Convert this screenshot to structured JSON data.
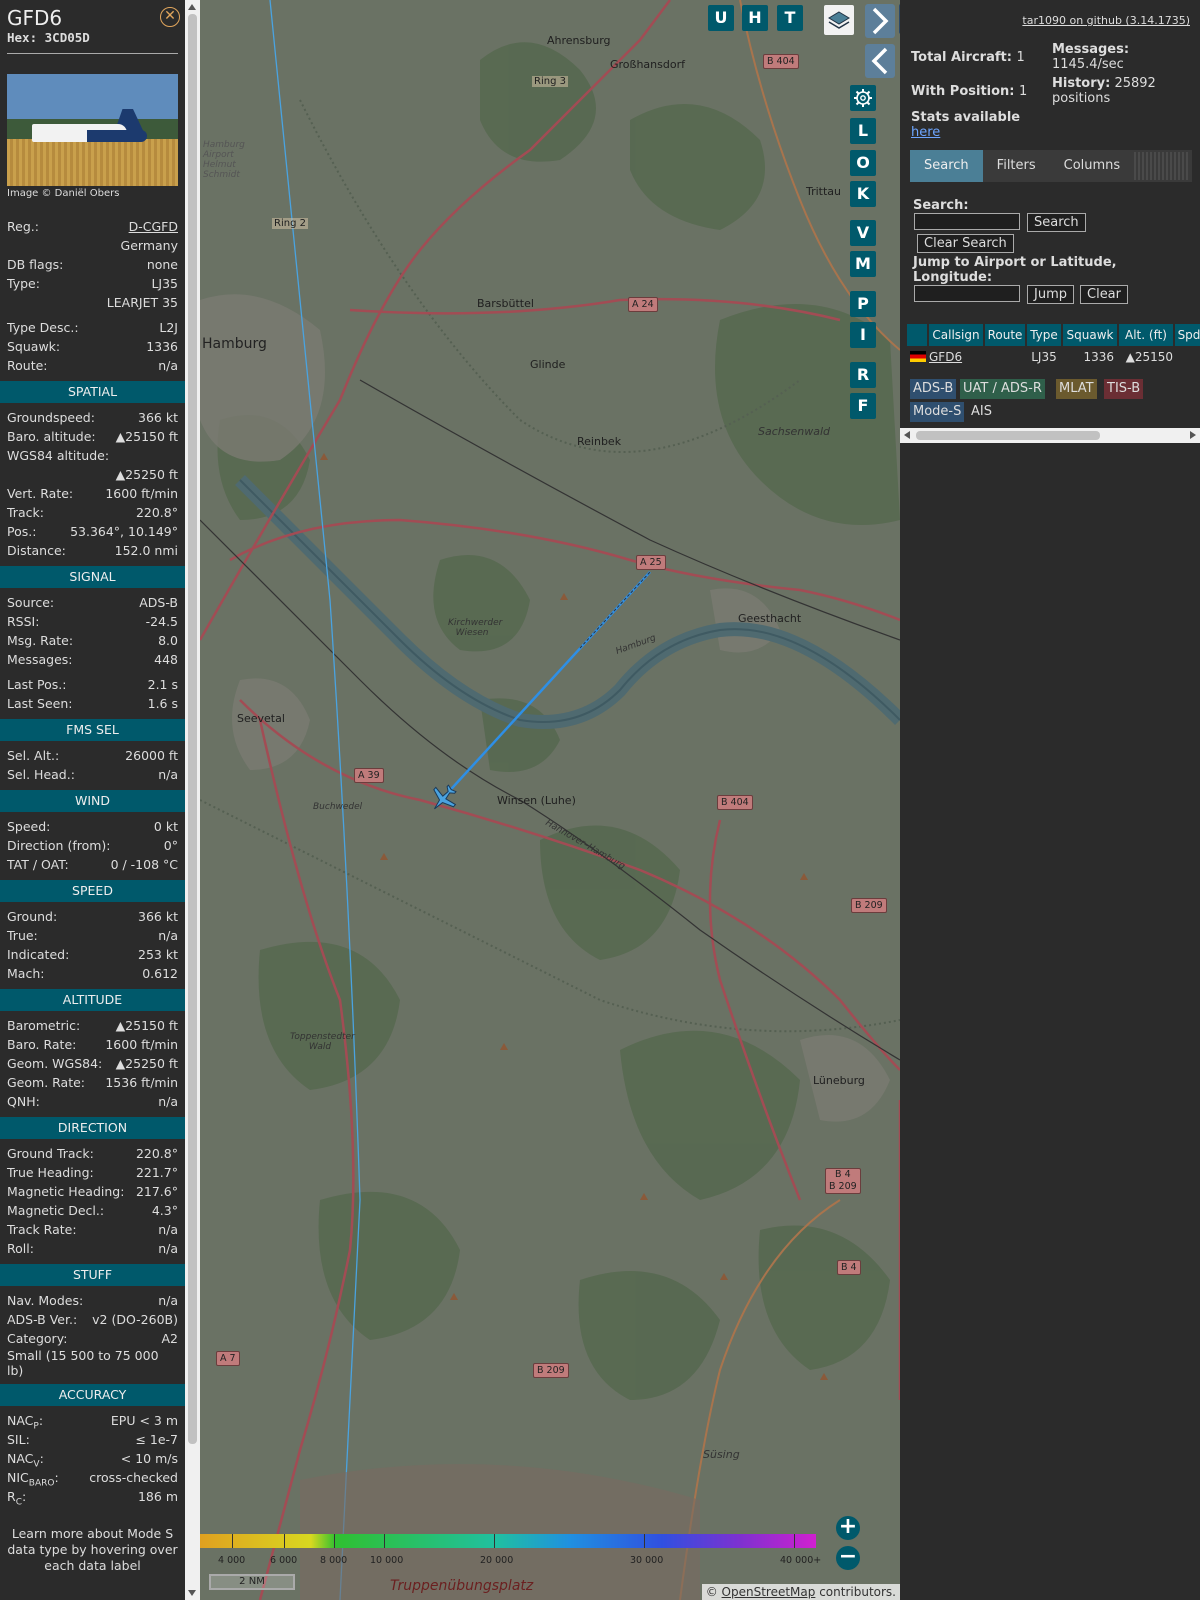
{
  "sidebar": {
    "callsign": "GFD6",
    "hex_label": "Hex:",
    "hex": "3CD05D",
    "close_icon": "close-circle-icon",
    "photo_credit": "Image © Daniël Obers",
    "info": [
      {
        "k": "Reg.:",
        "v": "D-CGFD",
        "link": true
      },
      {
        "k": "",
        "v": "Germany"
      },
      {
        "k": "DB flags:",
        "v": "none"
      },
      {
        "k": "Type:",
        "v": "LJ35"
      },
      {
        "k": "",
        "v": "LEARJET 35"
      },
      {
        "k": "Type Desc.:",
        "v": "L2J"
      },
      {
        "k": "Squawk:",
        "v": "1336"
      },
      {
        "k": "Route:",
        "v": "n/a"
      }
    ],
    "sections": {
      "spatial": {
        "title": "SPATIAL",
        "rows": [
          {
            "k": "Groundspeed:",
            "v": "366 kt"
          },
          {
            "k": "Baro. altitude:",
            "v": "▲25150 ft"
          },
          {
            "k": "WGS84 altitude:",
            "v": ""
          },
          {
            "k": "",
            "v": "▲25250 ft"
          },
          {
            "k": "Vert. Rate:",
            "v": "1600 ft/min"
          },
          {
            "k": "Track:",
            "v": "220.8°"
          },
          {
            "k": "Pos.:",
            "v": "53.364°, 10.149°"
          },
          {
            "k": "Distance:",
            "v": "152.0 nmi"
          }
        ]
      },
      "signal": {
        "title": "SIGNAL",
        "rows": [
          {
            "k": "Source:",
            "v": "ADS-B"
          },
          {
            "k": "RSSI:",
            "v": "-24.5"
          },
          {
            "k": "Msg. Rate:",
            "v": "8.0"
          },
          {
            "k": "Messages:",
            "v": "448"
          },
          {
            "k": "Last Pos.:",
            "v": "2.1 s"
          },
          {
            "k": "Last Seen:",
            "v": "1.6 s"
          }
        ]
      },
      "fms": {
        "title": "FMS SEL",
        "rows": [
          {
            "k": "Sel. Alt.:",
            "v": "26000 ft"
          },
          {
            "k": "Sel. Head.:",
            "v": "n/a"
          }
        ]
      },
      "wind": {
        "title": "WIND",
        "rows": [
          {
            "k": "Speed:",
            "v": "0 kt"
          },
          {
            "k": "Direction (from):",
            "v": "0°"
          },
          {
            "k": "TAT / OAT:",
            "v": "0 / -108 °C"
          }
        ]
      },
      "speed": {
        "title": "SPEED",
        "rows": [
          {
            "k": "Ground:",
            "v": "366 kt"
          },
          {
            "k": "True:",
            "v": "n/a"
          },
          {
            "k": "Indicated:",
            "v": "253 kt"
          },
          {
            "k": "Mach:",
            "v": "0.612"
          }
        ]
      },
      "altitude": {
        "title": "ALTITUDE",
        "rows": [
          {
            "k": "Barometric:",
            "v": "▲25150 ft"
          },
          {
            "k": "Baro. Rate:",
            "v": "1600 ft/min"
          },
          {
            "k": "Geom. WGS84:",
            "v": "▲25250 ft"
          },
          {
            "k": "Geom. Rate:",
            "v": "1536 ft/min"
          },
          {
            "k": "QNH:",
            "v": "n/a"
          }
        ]
      },
      "direction": {
        "title": "DIRECTION",
        "rows": [
          {
            "k": "Ground Track:",
            "v": "220.8°"
          },
          {
            "k": "True Heading:",
            "v": "221.7°"
          },
          {
            "k": "Magnetic Heading:",
            "v": "217.6°"
          },
          {
            "k": "Magnetic Decl.:",
            "v": "4.3°"
          },
          {
            "k": "Track Rate:",
            "v": "n/a"
          },
          {
            "k": "Roll:",
            "v": "n/a"
          }
        ]
      },
      "stuff": {
        "title": "STUFF",
        "rows": [
          {
            "k": "Nav. Modes:",
            "v": "n/a"
          },
          {
            "k": "ADS-B Ver.:",
            "v": "v2 (DO-260B)"
          },
          {
            "k": "Category:",
            "v": "A2"
          }
        ],
        "category_desc": "Small (15 500 to 75 000 lb)"
      },
      "accuracy": {
        "title": "ACCURACY",
        "rows": [
          {
            "k": "NACP:",
            "v": "EPU < 3 m"
          },
          {
            "k": "SIL:",
            "v": "≤ 1e-7"
          },
          {
            "k": "NACV:",
            "v": "< 10 m/s"
          },
          {
            "k": "NICBARO:",
            "v": "cross-checked"
          },
          {
            "k": "RC:",
            "v": "186 m"
          }
        ]
      }
    },
    "footnote": "Learn more about Mode S data type by hovering over each data label"
  },
  "map": {
    "buttons": {
      "u": "U",
      "h": "H",
      "t": "T",
      "l": "L",
      "o": "O",
      "k": "K",
      "v": "V",
      "m": "M",
      "p": "P",
      "i": "I",
      "r": "R",
      "f": "F"
    },
    "places": {
      "ahrensburg": "Ahrensburg",
      "grosshansdorf": "Großhansdorf",
      "trittau": "Trittau",
      "barsbuettel": "Barsbüttel",
      "hamburg": "Hamburg",
      "glinde": "Glinde",
      "reinbek": "Reinbek",
      "sachsenwald": "Sachsenwald",
      "geesthacht": "Geesthacht",
      "seevetal": "Seevetal",
      "winsen": "Winsen (Luhe)",
      "lueneburg": "Lüneburg",
      "kirchwerder": "Kirchwerder Wiesen",
      "buchwedel": "Buchwedel",
      "toppenstedt": "Toppenstedter Wald",
      "suesing": "Süsing",
      "truppen": "Truppenübungsplatz",
      "airport": "Hamburg Airport Helmut Schmidt",
      "ring3": "Ring 3",
      "ring2": "Ring 2",
      "hannover_hamburg": "Hannover–Hamburg",
      "hamburg_river": "Hamburg"
    },
    "roads": {
      "b404a": "B 404",
      "a24": "A 24",
      "a25": "A 25",
      "a39": "A 39",
      "b404b": "B 404",
      "b209a": "B 209",
      "b4a": "B 4",
      "b209b": "B 209",
      "b4b": "B 4",
      "a7": "A 7",
      "b209c": "B 209"
    },
    "alt_ticks": [
      "4 000",
      "6 000",
      "8 000",
      "10 000",
      "20 000",
      "30 000",
      "40 000+"
    ],
    "scale": "2 NM",
    "attribution_prefix": "©",
    "attribution_link": "OpenStreetMap",
    "attribution_suffix": " contributors."
  },
  "panel": {
    "github_link": "tar1090 on github (3.14.1735)",
    "total_label": "Total Aircraft:",
    "total_value": "1",
    "withpos_label": "With Position:",
    "withpos_value": "1",
    "stats_label": "Stats available",
    "stats_link": "here",
    "messages_label": "Messages:",
    "messages_value": "1145.4/sec",
    "history_label": "History:",
    "history_value": "25892 positions",
    "tabs": [
      "Search",
      "Filters",
      "Columns"
    ],
    "search_label": "Search:",
    "search_button": "Search",
    "clear_search_button": "Clear Search",
    "jump_label": "Jump to Airport or Latitude, Longitude:",
    "jump_button": "Jump",
    "clear_button": "Clear",
    "table": {
      "headers": [
        "",
        "Callsign",
        "Route",
        "Type",
        "Squawk",
        "Alt. (ft)",
        "Spd"
      ],
      "rows": [
        {
          "callsign": "GFD6",
          "route": "",
          "type": "LJ35",
          "squawk": "1336",
          "alt": "▲25150",
          "spd": ""
        }
      ]
    },
    "legend": [
      {
        "label": "ADS-B",
        "color": "#2f4f6f"
      },
      {
        "label": "UAT / ADS-R",
        "color": "#2f5f4a"
      },
      {
        "label": "MLAT",
        "color": "#6b5a2e"
      },
      {
        "label": "TIS-B",
        "color": "#6b2e34"
      },
      {
        "label": "Mode-S",
        "color": "#2f4f6f"
      },
      {
        "label": "AIS",
        "color": "#2b2b2b"
      }
    ]
  }
}
